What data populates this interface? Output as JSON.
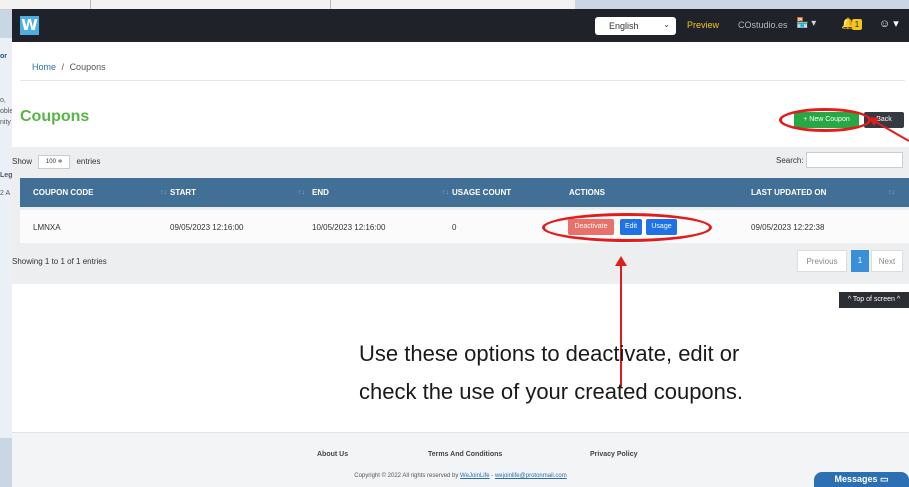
{
  "header": {
    "logo_letter": "W",
    "language": "English",
    "preview": "Preview",
    "site": "COstudio.es",
    "notification_count": "1"
  },
  "breadcrumb": {
    "home": "Home",
    "separator": "/",
    "current": "Coupons"
  },
  "page": {
    "title": "Coupons",
    "new_coupon": "+ New Coupon",
    "back": "Back"
  },
  "table_controls": {
    "show": "Show",
    "entries_value": "100 ≑",
    "entries": "entries",
    "search": "Search:"
  },
  "table": {
    "columns": [
      "COUPON CODE",
      "START",
      "END",
      "USAGE COUNT",
      "ACTIONS",
      "LAST UPDATED ON"
    ],
    "rows": [
      {
        "code": "LMNXA",
        "start": "09/05/2023 12:16:00",
        "end": "10/05/2023 12:16:00",
        "usage_count": "0",
        "last_updated": "09/05/2023 12:22:38"
      }
    ],
    "actions": {
      "deactivate": "Deactivate",
      "edit": "Edit",
      "usage": "Usage"
    }
  },
  "pagination": {
    "info": "Showing 1 to 1 of 1 entries",
    "previous": "Previous",
    "page": "1",
    "next": "Next"
  },
  "top_of_screen": "^ Top of screen ^",
  "annotation": {
    "line1": "Use these options to deactivate, edit or",
    "line2": "check the use of your created coupons."
  },
  "footer": {
    "about": "About Us",
    "terms": "Terms And Conditions",
    "privacy": "Privacy Policy",
    "copyright": "Copyright © 2022 All rights reserved by",
    "brand": "WeJoinLife",
    "dash": "-",
    "email": "wejoinlife@protonmail.com"
  },
  "messages": "Messages",
  "background_window": {
    "fragments": [
      "or",
      "o, ",
      "oble",
      "nity",
      "Leg",
      "2 A"
    ]
  },
  "colors": {
    "topbar": "#1f2329",
    "title_green": "#57b547",
    "table_header": "#416f96",
    "annotation_red": "#e21c1c",
    "primary_blue": "#1e72e6"
  }
}
